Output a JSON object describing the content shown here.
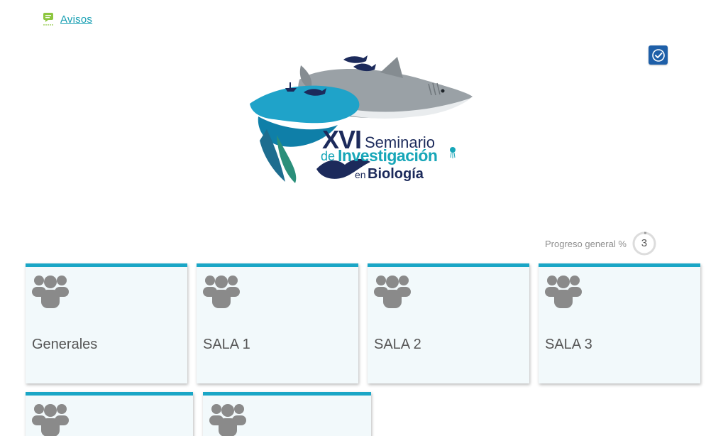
{
  "avisos": {
    "label": "Avisos",
    "icon": "chat-bubble-icon"
  },
  "status_badge": {
    "icon": "check-circle-icon",
    "color": "#1e5fa8"
  },
  "banner": {
    "line1_big": "XVI",
    "line1_small": "Seminario",
    "line2_small": "de",
    "line2_big": "Investigación",
    "line3_small": "en",
    "line3_big": "Biología"
  },
  "progress": {
    "label": "Progreso general %",
    "value": "3",
    "percent": 3
  },
  "colors": {
    "accent": "#1aa6c6",
    "card_bg": "#f2f9fb",
    "link": "#179fb3"
  },
  "cards": [
    {
      "label": "Generales"
    },
    {
      "label": "SALA 1"
    },
    {
      "label": "SALA 2"
    },
    {
      "label": "SALA 3"
    },
    {
      "label": ""
    },
    {
      "label": ""
    }
  ]
}
